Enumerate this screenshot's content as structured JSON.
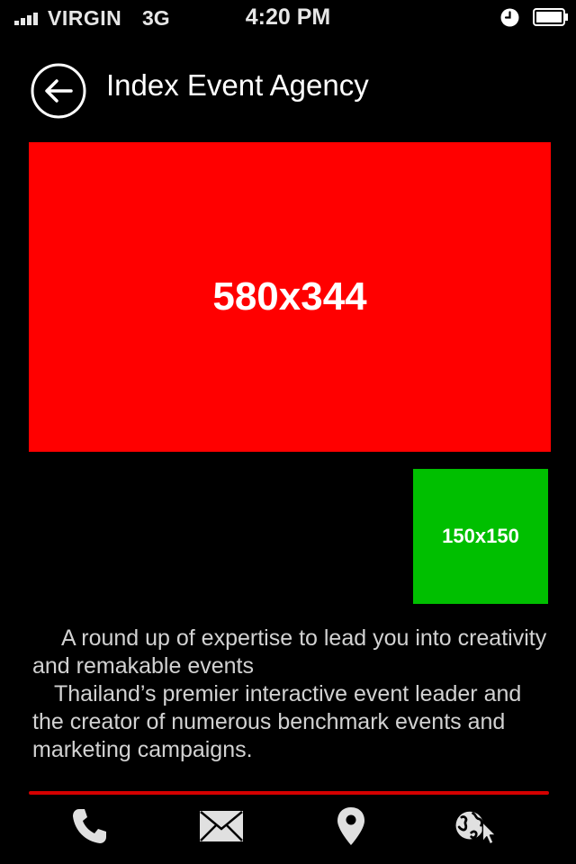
{
  "status_bar": {
    "carrier": "VIRGIN",
    "network": "3G",
    "time": "4:20 PM",
    "icons": [
      "signal-icon",
      "alarm-icon",
      "battery-icon"
    ]
  },
  "header": {
    "title": "Index Event Agency",
    "back_icon": "back-arrow-icon"
  },
  "hero": {
    "label": "580x344",
    "color": "#ff0000"
  },
  "thumbnail": {
    "label": "150x150",
    "color": "#00bf00"
  },
  "description": {
    "paragraph1": "A round up of expertise to lead you into creativity and remakable events",
    "paragraph2": "Thailand’s premier interactive event leader and the creator of numerous benchmark events and marketing campaigns."
  },
  "toolbar": {
    "accent": "#d40000",
    "items": [
      {
        "icon": "phone-icon"
      },
      {
        "icon": "mail-icon"
      },
      {
        "icon": "map-pin-icon"
      },
      {
        "icon": "web-icon"
      }
    ]
  }
}
